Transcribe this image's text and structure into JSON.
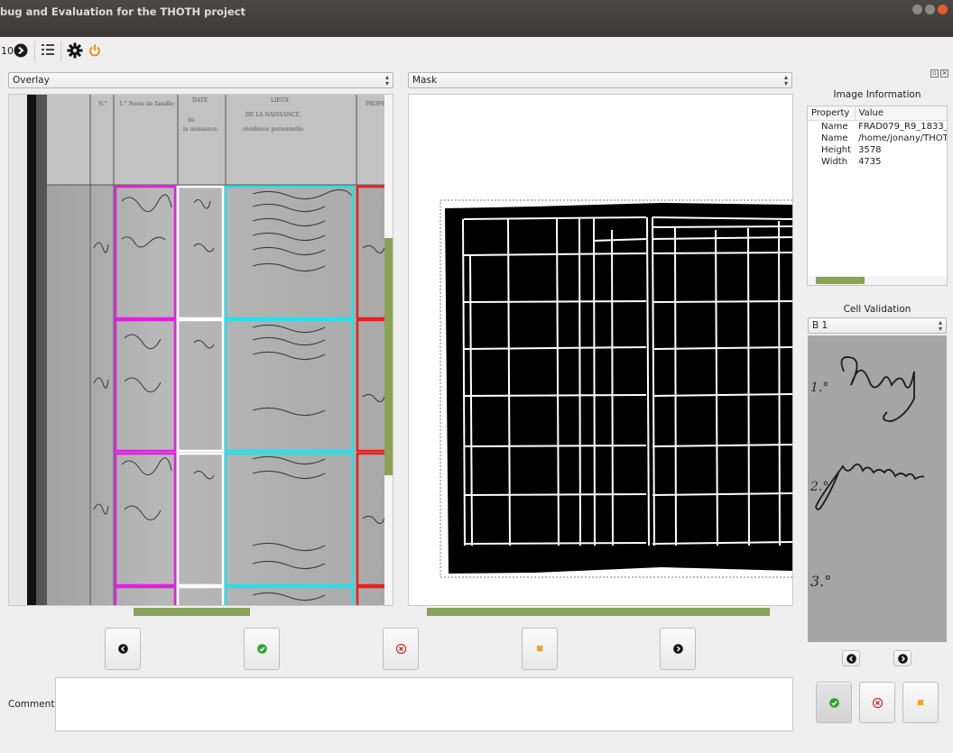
{
  "window": {
    "title": "bug and Evaluation for the THOTH project"
  },
  "toolbar": {
    "page_number": "10"
  },
  "left_view": {
    "mode": "Overlay"
  },
  "middle_view": {
    "mode": "Mask"
  },
  "image_info": {
    "title": "Image Information",
    "headers": [
      "Property",
      "Value"
    ],
    "rows": [
      {
        "property": "Name",
        "value": "FRAD079_R9_1833_("
      },
      {
        "property": "Name",
        "value": "/home/jonany/THOT"
      },
      {
        "property": "Height",
        "value": "3578"
      },
      {
        "property": "Width",
        "value": "4735"
      }
    ]
  },
  "cell_validation": {
    "title": "Cell Validation",
    "selected_cell": "B 1"
  },
  "comments": {
    "label": "Comments:",
    "value": ""
  },
  "colors": {
    "accent_green": "#8aa25a",
    "magenta": "#e020e0",
    "cyan": "#28e0e8",
    "red": "#e82020",
    "approve": "#2aa52a",
    "reject": "#d42020",
    "flag": "#f5a020"
  }
}
